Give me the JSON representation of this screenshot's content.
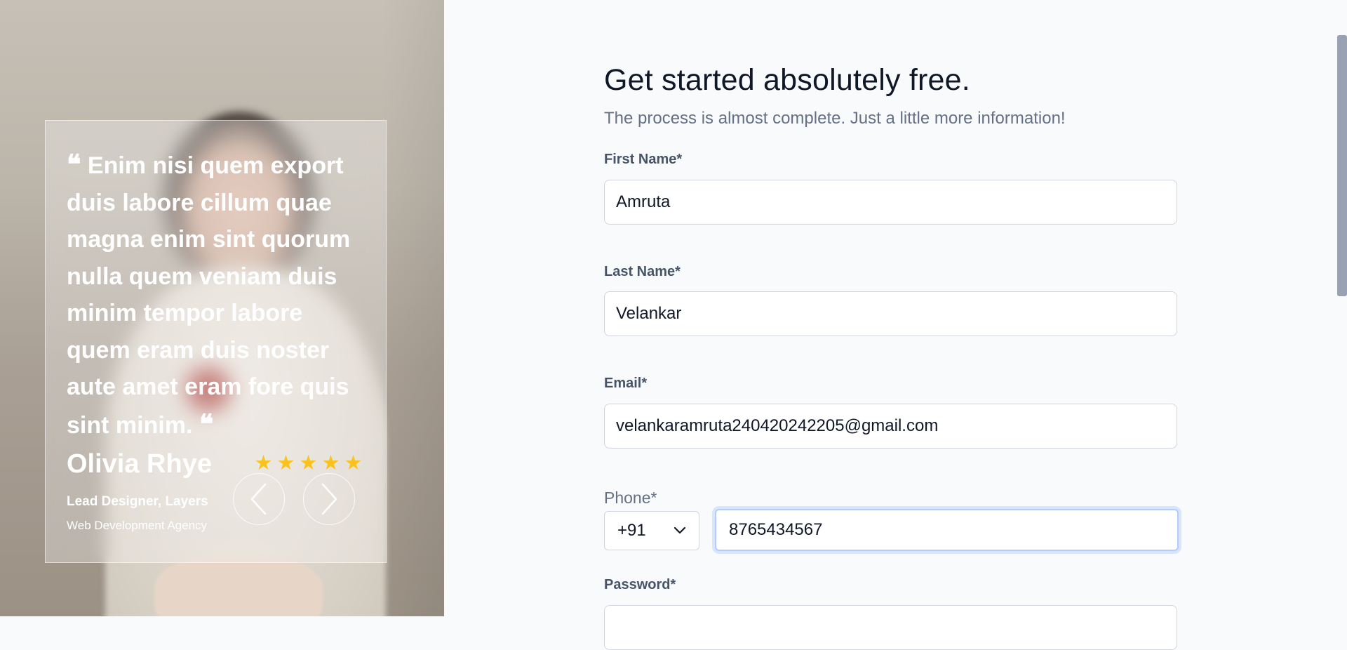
{
  "testimonial": {
    "quote": "Enim nisi quem export duis labore cillum quae magna enim sint quorum nulla quem veniam duis minim tempor labore quem eram duis noster aute amet eram fore quis sint minim.",
    "author_name": "Olivia Rhye",
    "author_role": "Lead Designer, Layers",
    "author_company": "Web Development Agency",
    "rating": 5,
    "star_color": "#f8c31d"
  },
  "form": {
    "title": "Get started absolutely free.",
    "subtitle": "The process is almost complete. Just a little more information!",
    "first_name": {
      "label": "First Name*",
      "value": "Amruta"
    },
    "last_name": {
      "label": "Last Name*",
      "value": "Velankar"
    },
    "email": {
      "label": "Email*",
      "value": "velankaramruta240420242205@gmail.com"
    },
    "phone": {
      "label": "Phone*",
      "country_code": "+91",
      "value": "8765434567"
    },
    "password": {
      "label": "Password*"
    }
  },
  "colors": {
    "focus_ring": "#b2ccff",
    "heading": "#101828",
    "muted": "#667085"
  }
}
